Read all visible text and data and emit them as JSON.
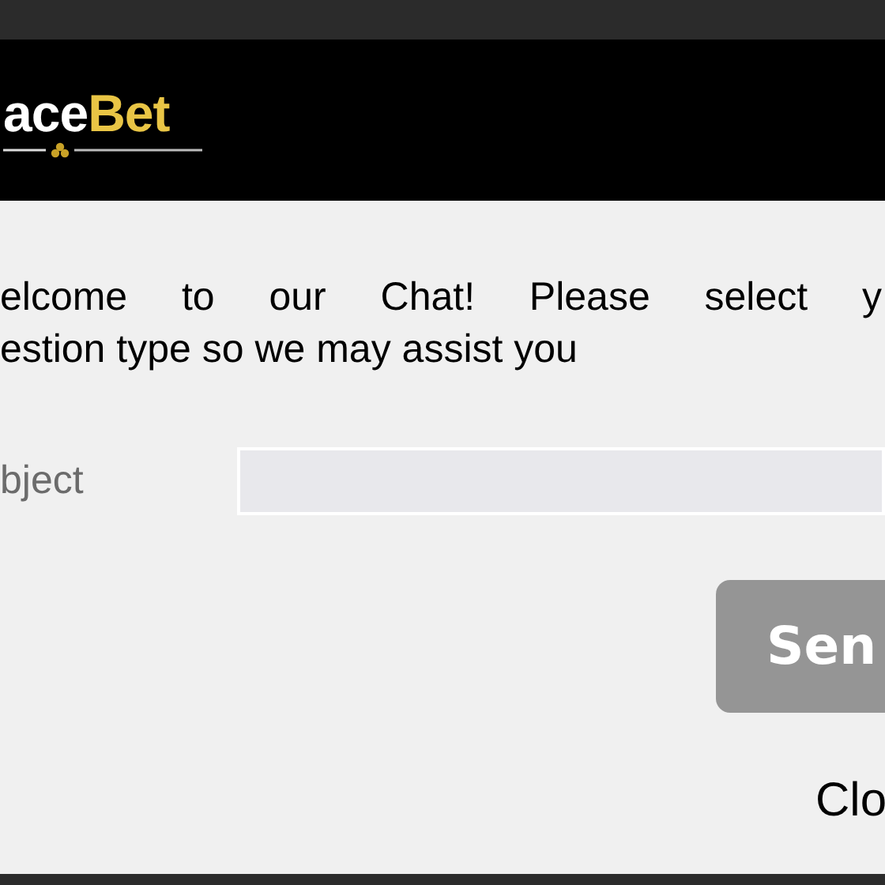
{
  "logo": {
    "first": "ace",
    "second": "Bet"
  },
  "welcome": {
    "line_1": "elcome to our Chat! Please select y",
    "line_2": "estion type so we may assist you"
  },
  "subject": {
    "label": "bject"
  },
  "send_button": "Sen",
  "close_link": "Clo"
}
